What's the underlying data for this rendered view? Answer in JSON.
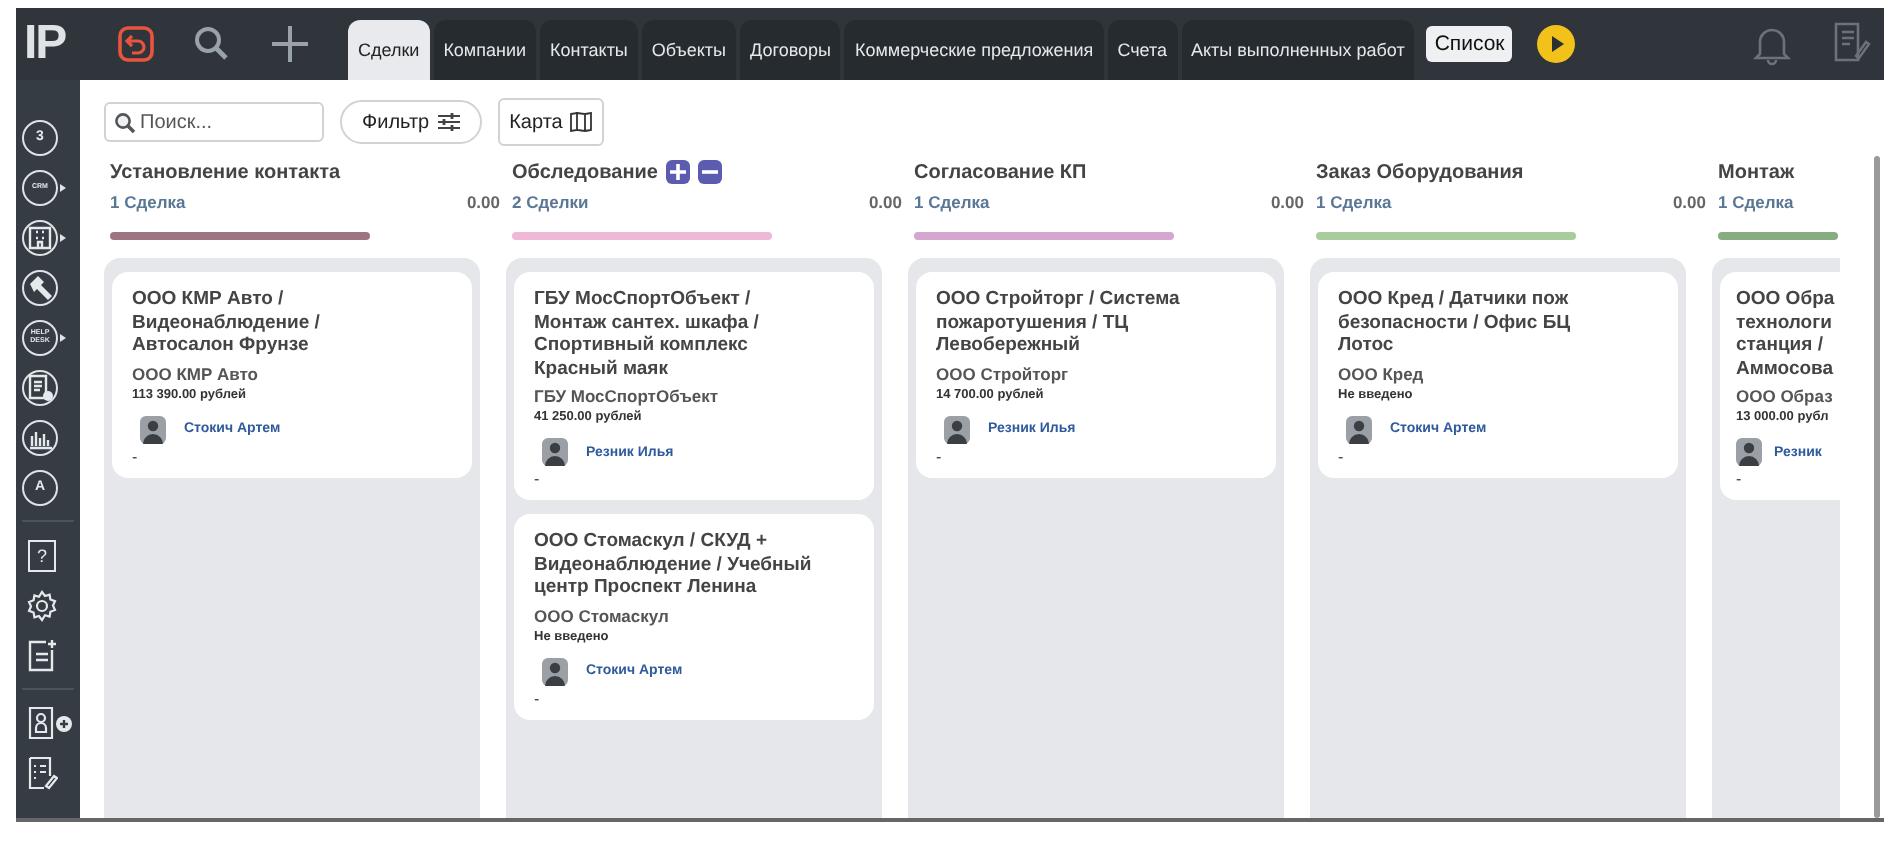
{
  "logo": {
    "text": "IP"
  },
  "tabs": [
    {
      "label": "Сделки",
      "selected": true
    },
    {
      "label": "Компании",
      "selected": false
    },
    {
      "label": "Контакты",
      "selected": false
    },
    {
      "label": "Объекты",
      "selected": false
    },
    {
      "label": "Договоры",
      "selected": false
    },
    {
      "label": "Коммерческие предложения",
      "selected": false
    },
    {
      "label": "Счета",
      "selected": false
    },
    {
      "label": "Акты выполненных работ",
      "selected": false
    }
  ],
  "view_button": {
    "label": "Список"
  },
  "sidebar": {
    "items": [
      {
        "kind": "calendar",
        "text": "3",
        "submenu": false
      },
      {
        "kind": "crm",
        "text": "CRM",
        "submenu": true
      },
      {
        "kind": "building",
        "submenu": true
      },
      {
        "kind": "hammer",
        "submenu": false
      },
      {
        "kind": "helpdesk",
        "text": "HELP DESK",
        "submenu": true
      },
      {
        "kind": "ledger",
        "submenu": false
      },
      {
        "kind": "chart",
        "submenu": false
      },
      {
        "kind": "contract",
        "text": "A",
        "submenu": false
      }
    ],
    "bottom_items": [
      {
        "kind": "help",
        "text": "?"
      },
      {
        "kind": "settings"
      },
      {
        "kind": "note-add"
      },
      {
        "kind": "contact-add"
      },
      {
        "kind": "checklist"
      }
    ]
  },
  "toolbar": {
    "search": {
      "placeholder": "Поиск..."
    },
    "filter_button": "Фильтр",
    "map_button": "Карта"
  },
  "columns": [
    {
      "title": "Установление контакта",
      "count": "1 Сделка",
      "amount": "0.00",
      "color": "#9c7482",
      "controls": false,
      "cards": [
        {
          "title": "ООО КМР Авто / Видеонаблюдение / Автосалон Фрунзе",
          "company": "ООО КМР Авто",
          "amount": "113 390.00 рублей",
          "manager": "Стокич Артем",
          "note": "-"
        }
      ]
    },
    {
      "title": "Обследование",
      "count": "2 Сделки",
      "amount": "0.00",
      "color": "#efb8d6",
      "controls": true,
      "cards": [
        {
          "title": "ГБУ МосСпортОбъект / Монтаж сантех. шкафа / Спортивный комплекс Красный маяк",
          "company": "ГБУ МосСпортОбъект",
          "amount": "41 250.00 рублей",
          "manager": "Резник Илья",
          "note": "-"
        },
        {
          "title": "ООО Стомаскул / СКУД + Видеонаблюдение / Учебный центр Проспект Ленина",
          "company": "ООО Стомаскул",
          "amount": "Не введено",
          "manager": "Стокич Артем",
          "note": "-"
        }
      ]
    },
    {
      "title": "Согласование КП",
      "count": "1 Сделка",
      "amount": "0.00",
      "color": "#d5a6cf",
      "controls": false,
      "cards": [
        {
          "title": "ООО Стройторг / Система пожаротушения / ТЦ Левобережный",
          "company": "ООО Стройторг",
          "amount": "14 700.00 рублей",
          "manager": "Резник Илья",
          "note": "-"
        }
      ]
    },
    {
      "title": "Заказ Оборудования",
      "count": "1 Сделка",
      "amount": "0.00",
      "color": "#a9cc9d",
      "controls": false,
      "cards": [
        {
          "title": "ООО Кред / Датчики пож безопасности / Офис БЦ Лотос",
          "company": "ООО Кред",
          "amount": "Не введено",
          "manager": "Стокич Артем",
          "note": "-"
        }
      ]
    },
    {
      "title": "Монтаж",
      "count": "1 Сделка",
      "color": "#86ad80",
      "controls": false,
      "cards": [
        {
          "title": "ООО Обра\nтехнологи\nстанция /\nАммосова",
          "company": "ООО Образ",
          "amount": "13 000.00 рубл",
          "manager": "Резник",
          "note": "-"
        }
      ]
    }
  ]
}
